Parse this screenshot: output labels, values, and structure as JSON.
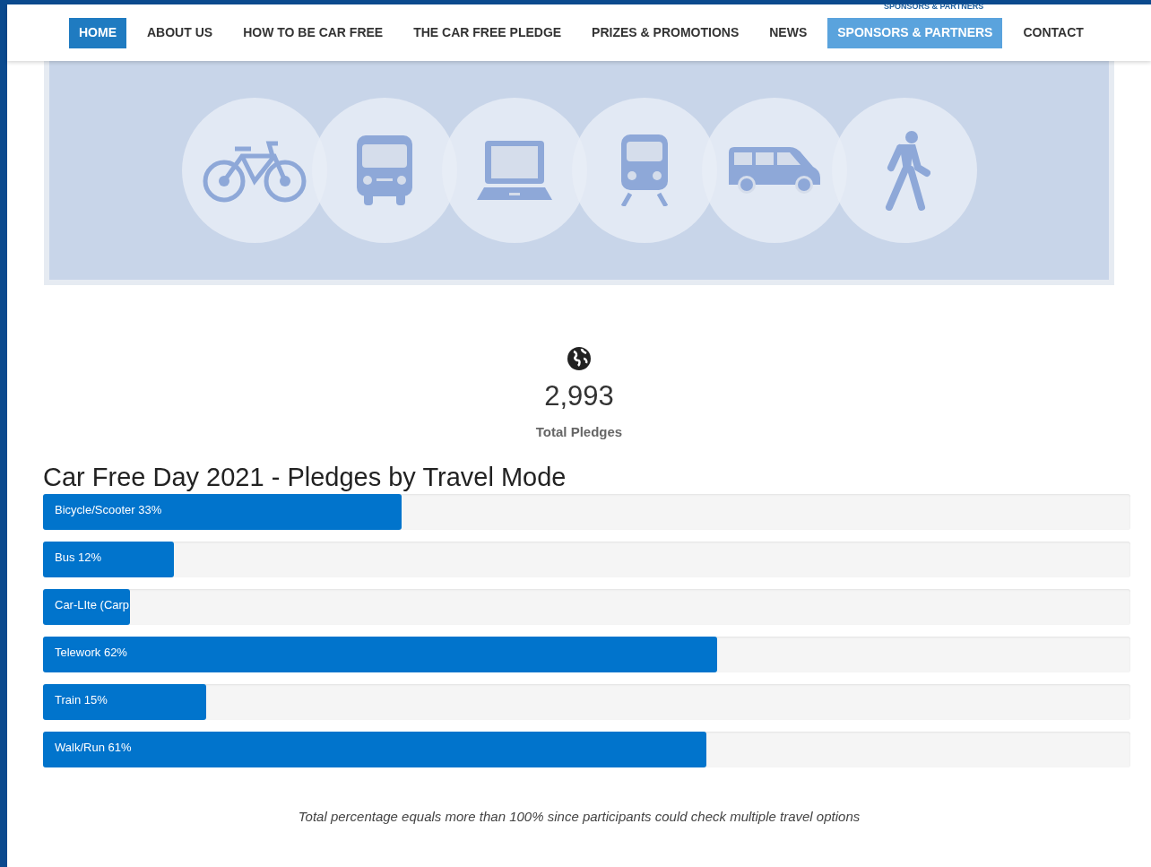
{
  "nav": {
    "items": [
      {
        "label": "HOME",
        "selected": true
      },
      {
        "label": "ABOUT US",
        "selected": false
      },
      {
        "label": "HOW TO BE CAR FREE",
        "selected": false
      },
      {
        "label": "THE CAR FREE PLEDGE",
        "selected": false
      },
      {
        "label": "PRIZES & PROMOTIONS",
        "selected": false
      },
      {
        "label": "NEWS",
        "selected": false
      },
      {
        "label": "SPONSORS & PARTNERS",
        "selected": false,
        "hovered": true
      },
      {
        "label": "CONTACT",
        "selected": false
      }
    ],
    "dropdown_peek": "SPONSORS & PARTNERS"
  },
  "banner": {
    "icons": [
      {
        "kind": "bicycle"
      },
      {
        "kind": "bus"
      },
      {
        "kind": "laptop"
      },
      {
        "kind": "train"
      },
      {
        "kind": "van"
      },
      {
        "kind": "walker"
      }
    ]
  },
  "stats": {
    "value": "2,993",
    "label": "Total Pledges"
  },
  "chart": {
    "title": "Car Free Day 2021 - Pledges by Travel Mode",
    "bars": [
      {
        "label": "Bicycle/Scooter 33%",
        "level": 0.33
      },
      {
        "label": "Bus 12%",
        "level": 0.12
      },
      {
        "label": "Car-LIte (Carp",
        "level": 0.08
      },
      {
        "label": "Telework 62%",
        "level": 0.62
      },
      {
        "label": "Train 15%",
        "level": 0.15
      },
      {
        "label": "Walk/Run 61%",
        "level": 0.61
      }
    ]
  },
  "footnote": "Total percentage equals more than 100% since participants could check multiple travel options"
}
